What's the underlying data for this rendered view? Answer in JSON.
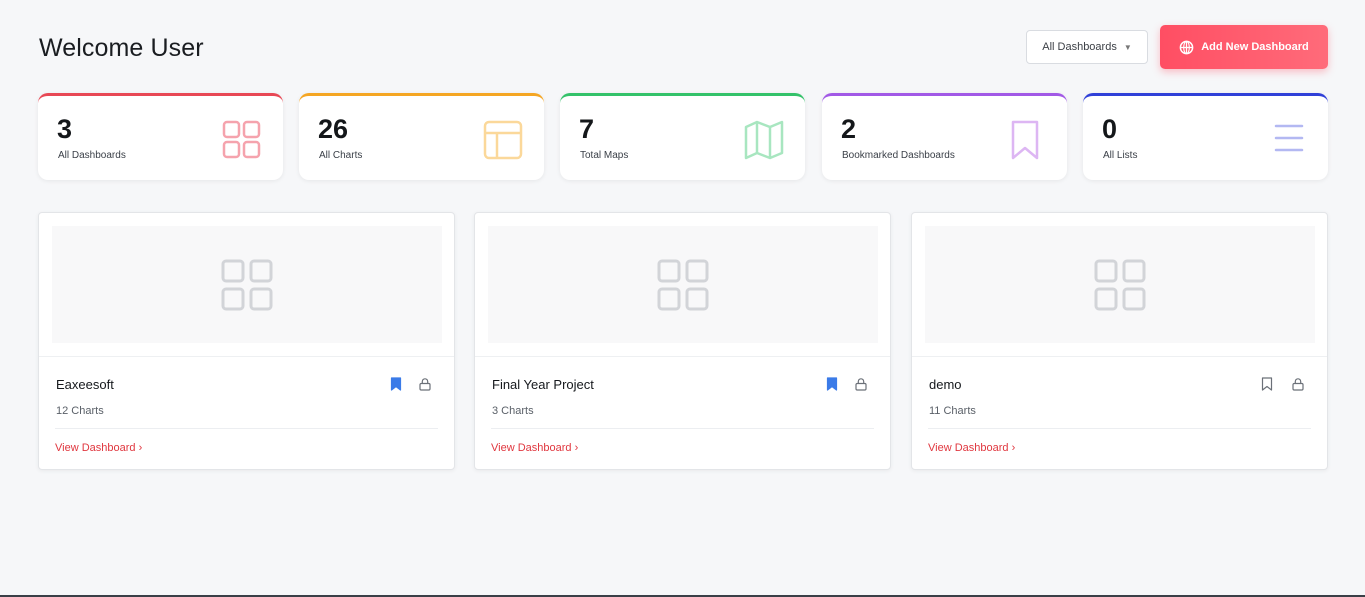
{
  "header": {
    "title": "Welcome User",
    "filter_label": "All Dashboards",
    "add_label": "Add New Dashboard"
  },
  "stats": [
    {
      "value": "3",
      "label": "All Dashboards",
      "icon": "grid-icon",
      "color": "#e84855"
    },
    {
      "value": "26",
      "label": "All Charts",
      "icon": "layout-icon",
      "color": "#f5a623"
    },
    {
      "value": "7",
      "label": "Total Maps",
      "icon": "map-icon",
      "color": "#34c26a"
    },
    {
      "value": "2",
      "label": "Bookmarked Dashboards",
      "icon": "bookmark-icon",
      "color": "#a259e6"
    },
    {
      "value": "0",
      "label": "All Lists",
      "icon": "list-icon",
      "color": "#3040d8"
    }
  ],
  "dashboards": [
    {
      "title": "Eaxeesoft",
      "count": "12 Charts",
      "link": "View Dashboard ›",
      "bookmarked": true,
      "locked": true
    },
    {
      "title": "Final Year Project",
      "count": "3 Charts",
      "link": "View Dashboard ›",
      "bookmarked": true,
      "locked": true
    },
    {
      "title": "demo",
      "count": "11 Charts",
      "link": "View Dashboard ›",
      "bookmarked": false,
      "locked": true
    }
  ],
  "colors": {
    "accent": "#ff4e63",
    "link": "#e0373f",
    "bookmark_active": "#3b7be8",
    "bookmark_inactive": "#6b7078"
  }
}
